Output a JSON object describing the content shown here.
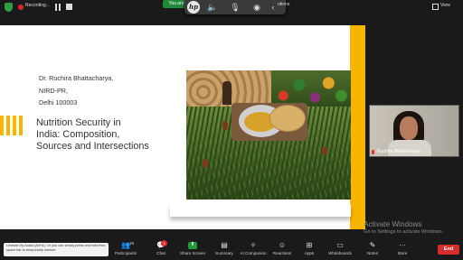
{
  "top_bar": {
    "recording_label": "Recording...",
    "viewing_label": "You are",
    "options_label": "otions",
    "view_label": "View",
    "hp_logo_text": "hp",
    "floating_icons": [
      "speaker-icon",
      "microphone-icon",
      "broadcast-icon",
      "back-icon"
    ]
  },
  "slide": {
    "author_lines": [
      "Dr. Ruchira Bhattacharya,",
      "NIRD-PR,",
      "Delhi 100003"
    ],
    "title_lines": [
      "Nutrition Security in",
      "India: Composition,",
      "Sources and Intersections"
    ],
    "accent_color": "#f7b500"
  },
  "participant": {
    "name": "Ruchira Bhattacharya",
    "muted": true
  },
  "watermark": {
    "line1": "Activate Windows",
    "line2": "Go to Settings to activate Windows."
  },
  "tooltip": {
    "text": "Unmute My Audio (Alt+A). Or you can simply press and hold the space bar to temporarily unmute.",
    "close": "×"
  },
  "toolbar": {
    "participants_label": "Participants",
    "participants_count": "19",
    "chat_label": "Chat",
    "chat_badge": "1",
    "share_label": "Share Screen",
    "summary_label": "Summary",
    "ai_label": "AI Companion",
    "reactions_label": "Reactions",
    "apps_label": "Apps",
    "whiteboards_label": "Whiteboards",
    "notes_label": "Notes",
    "more_label": "More",
    "end_label": "End"
  }
}
